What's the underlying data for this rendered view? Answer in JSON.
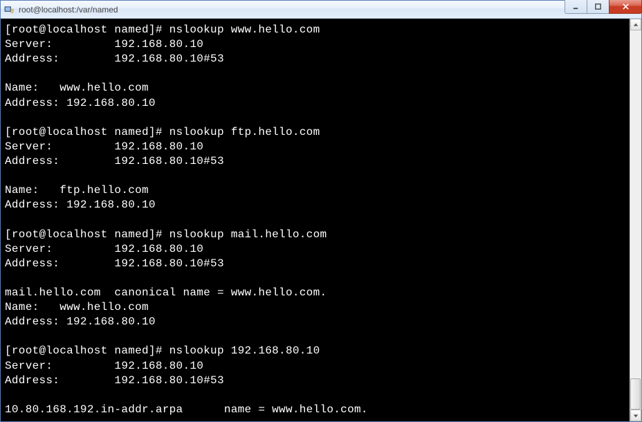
{
  "window": {
    "title": "root@localhost:/var/named"
  },
  "terminal": {
    "lines": [
      "[root@localhost named]# nslookup www.hello.com",
      "Server:         192.168.80.10",
      "Address:        192.168.80.10#53",
      "",
      "Name:   www.hello.com",
      "Address: 192.168.80.10",
      "",
      "[root@localhost named]# nslookup ftp.hello.com",
      "Server:         192.168.80.10",
      "Address:        192.168.80.10#53",
      "",
      "Name:   ftp.hello.com",
      "Address: 192.168.80.10",
      "",
      "[root@localhost named]# nslookup mail.hello.com",
      "Server:         192.168.80.10",
      "Address:        192.168.80.10#53",
      "",
      "mail.hello.com  canonical name = www.hello.com.",
      "Name:   www.hello.com",
      "Address: 192.168.80.10",
      "",
      "[root@localhost named]# nslookup 192.168.80.10",
      "Server:         192.168.80.10",
      "Address:        192.168.80.10#53",
      "",
      "10.80.168.192.in-addr.arpa      name = www.hello.com."
    ]
  }
}
